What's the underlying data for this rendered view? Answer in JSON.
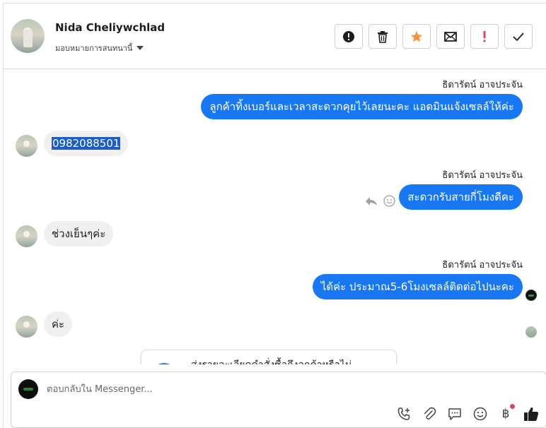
{
  "header": {
    "contact_name": "Nida Cheliywchlad",
    "assign_label": "มอบหมายการสนทนานี้",
    "actions": [
      {
        "name": "spam-button",
        "icon": "alert-circle-icon"
      },
      {
        "name": "delete-button",
        "icon": "trash-icon"
      },
      {
        "name": "star-button",
        "icon": "star-icon"
      },
      {
        "name": "mark-unread-button",
        "icon": "envelope-icon"
      },
      {
        "name": "important-button",
        "icon": "exclamation-icon"
      },
      {
        "name": "done-button",
        "icon": "check-icon"
      }
    ]
  },
  "messages": {
    "m1_sender": "ธิดารัตน์ อาจประจัน",
    "m1_text": "ลูกค้าทิ้งเบอร์และเวลาสะดวกคุยไว้เลยนะคะ แอดมินแจ้งเซลล์ให้ค่ะ",
    "m2_text": "0982088501",
    "m3_sender": "ธิดารัตน์ อาจประจัน",
    "m3_text": "สะดวกรับสายกี่โมงดีคะ",
    "m4_text": "ช่วงเย็นๆค่ะ",
    "m5_sender": "ธิดารัตน์ อาจประจัน",
    "m5_text": "ได้ค่ะ ประมาณ5-6โมงเซลล์ติดต่อไปนะคะ",
    "m6_text": "ค่ะ",
    "card_text": "ส่งรายละเอียดคำสั่งซื้อถึงลูกค้าหรือไม่"
  },
  "composer": {
    "placeholder": "ตอบกลับใน Messenger...",
    "tools": [
      "phone-plus-icon",
      "paperclip-icon",
      "chat-bubble-icon",
      "smiley-icon",
      "baht-icon",
      "thumbs-up-icon"
    ],
    "baht_symbol": "฿"
  },
  "colors": {
    "accent": "#1877f2",
    "star": "#f7923a",
    "important": "#e4405f",
    "bubble_in": "#f0f0f0"
  }
}
